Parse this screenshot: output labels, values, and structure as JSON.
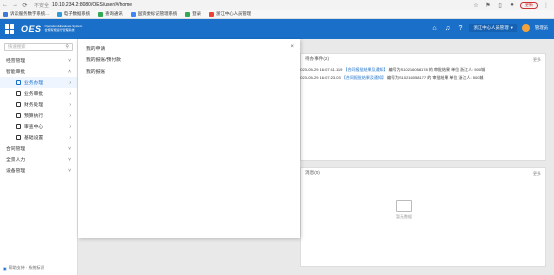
{
  "browser": {
    "security_label": "不安全",
    "url": "10.10.234.2:8080/OES/user/#/home",
    "update_label": "更新"
  },
  "bookmarks": [
    {
      "label": "诉讼服务数字系统...",
      "color": "#3d7ad6"
    },
    {
      "label": "电子数据系统",
      "color": "#2f9bd8"
    },
    {
      "label": "查询通讯",
      "color": "#34a853"
    },
    {
      "label": "国资委标记管理系统",
      "color": "#4285f4"
    },
    {
      "label": "登录",
      "color": "#34a853"
    },
    {
      "label": "浙江中心人员管理",
      "color": "#ea4335"
    }
  ],
  "header": {
    "logo_mark": "OES",
    "logo_sub_1": "Operation&Evaluate System",
    "logo_sub_2": "合规有规运行管理系统",
    "org_label": "浙江中心人员管理",
    "user_name": "管理员"
  },
  "sidebar": {
    "search_placeholder": "快速搜索",
    "items": [
      {
        "label": "经营管理",
        "sub": false,
        "active": false,
        "expanded": false
      },
      {
        "label": "智能审批",
        "sub": false,
        "active": false,
        "expanded": true
      },
      {
        "label": "业务办理",
        "sub": true,
        "active": true
      },
      {
        "label": "业务审批",
        "sub": true,
        "active": false
      },
      {
        "label": "财务处理",
        "sub": true,
        "active": false
      },
      {
        "label": "预算执行",
        "sub": true,
        "active": false
      },
      {
        "label": "审查中心",
        "sub": true,
        "active": false
      },
      {
        "label": "基础设置",
        "sub": true,
        "active": false
      },
      {
        "label": "合同管理",
        "sub": false,
        "active": false
      },
      {
        "label": "全景人力",
        "sub": false,
        "active": false
      },
      {
        "label": "设备管理",
        "sub": false,
        "active": false
      }
    ],
    "footer": "帮助支持 · 系统标识"
  },
  "popup": {
    "links": [
      "我的申请",
      "我的报账/预付款",
      "我的报账"
    ],
    "close": "×"
  },
  "cards": {
    "notice_title": "待办事件(2)",
    "notice_more": "更多",
    "notices": [
      {
        "date": "2023-05-29 16:07:11.119",
        "title": "【合同报批结果及通知】",
        "text": "编号为S10216058178 的 审批结果 单位 浙江人: 500城"
      },
      {
        "date": "2023-05-29 16:07:23.03",
        "title": "【合同报批结果及通知】",
        "text": "编号为S10216058177 的 审批结果 单位 浙江人: 500城"
      }
    ],
    "bottom_title": "消息(0)",
    "bottom_more": "更多",
    "empty_label": "暂无数据"
  }
}
